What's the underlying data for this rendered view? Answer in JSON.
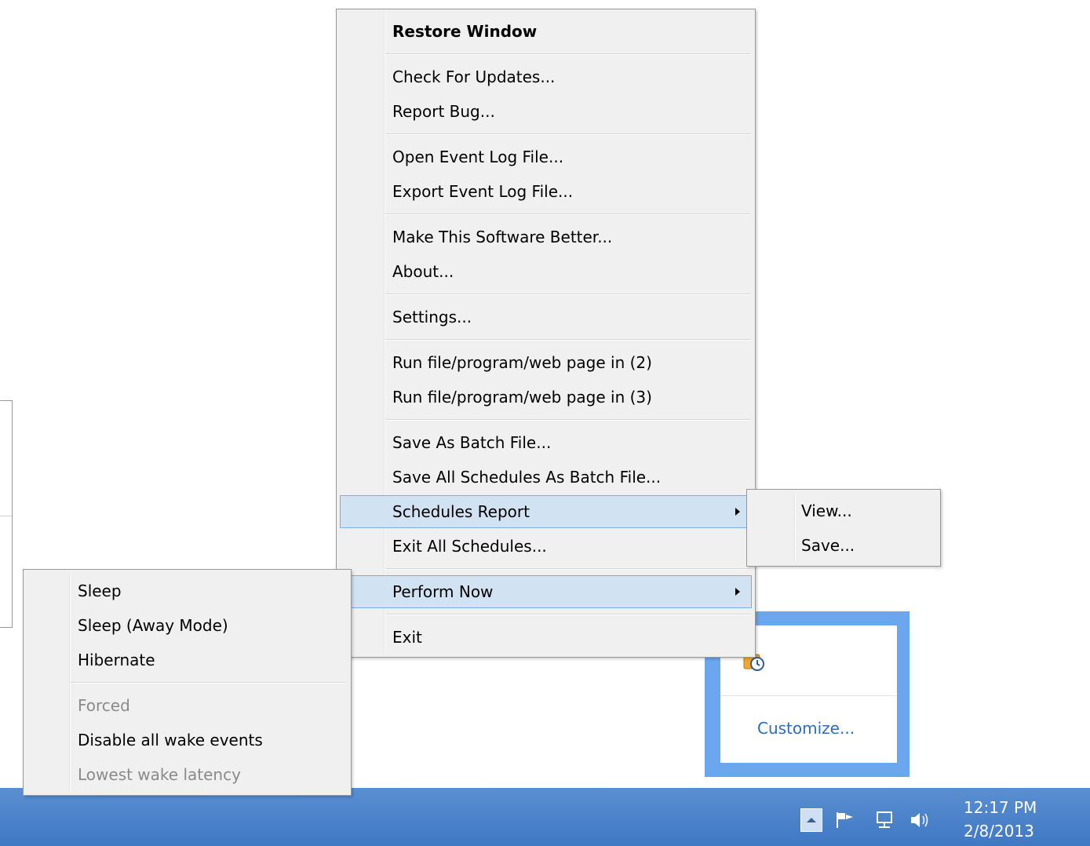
{
  "main_menu": {
    "items": [
      {
        "label": "Restore Window"
      },
      {
        "label": "Check For Updates..."
      },
      {
        "label": "Report Bug..."
      },
      {
        "label": "Open Event Log File..."
      },
      {
        "label": "Export Event Log File..."
      },
      {
        "label": "Make This Software Better..."
      },
      {
        "label": "About..."
      },
      {
        "label": "Settings..."
      },
      {
        "label": "Run file/program/web page in (2)"
      },
      {
        "label": "Run file/program/web page in (3)"
      },
      {
        "label": "Save As Batch File..."
      },
      {
        "label": "Save All Schedules As Batch File..."
      },
      {
        "label": "Schedules Report"
      },
      {
        "label": "Exit All Schedules..."
      },
      {
        "label": "Perform Now"
      },
      {
        "label": "Exit"
      }
    ]
  },
  "schedules_report_submenu": {
    "items": [
      {
        "label": "View..."
      },
      {
        "label": "Save..."
      }
    ]
  },
  "perform_now_submenu": {
    "items": [
      {
        "label": "Sleep"
      },
      {
        "label": "Sleep (Away Mode)"
      },
      {
        "label": "Hibernate"
      },
      {
        "label": "Forced",
        "disabled": true
      },
      {
        "label": "Disable all wake events"
      },
      {
        "label": "Lowest wake latency",
        "disabled": true
      }
    ]
  },
  "tray_overflow": {
    "customize_label": "Customize..."
  },
  "taskbar": {
    "time": "12:17 PM",
    "date": "2/8/2013",
    "color": "#4a83ca"
  },
  "colors": {
    "menu_bg": "#f0f0f0",
    "highlight_bg": "#d1e2f2",
    "highlight_border": "#78aee5",
    "link": "#2a6ebf"
  }
}
